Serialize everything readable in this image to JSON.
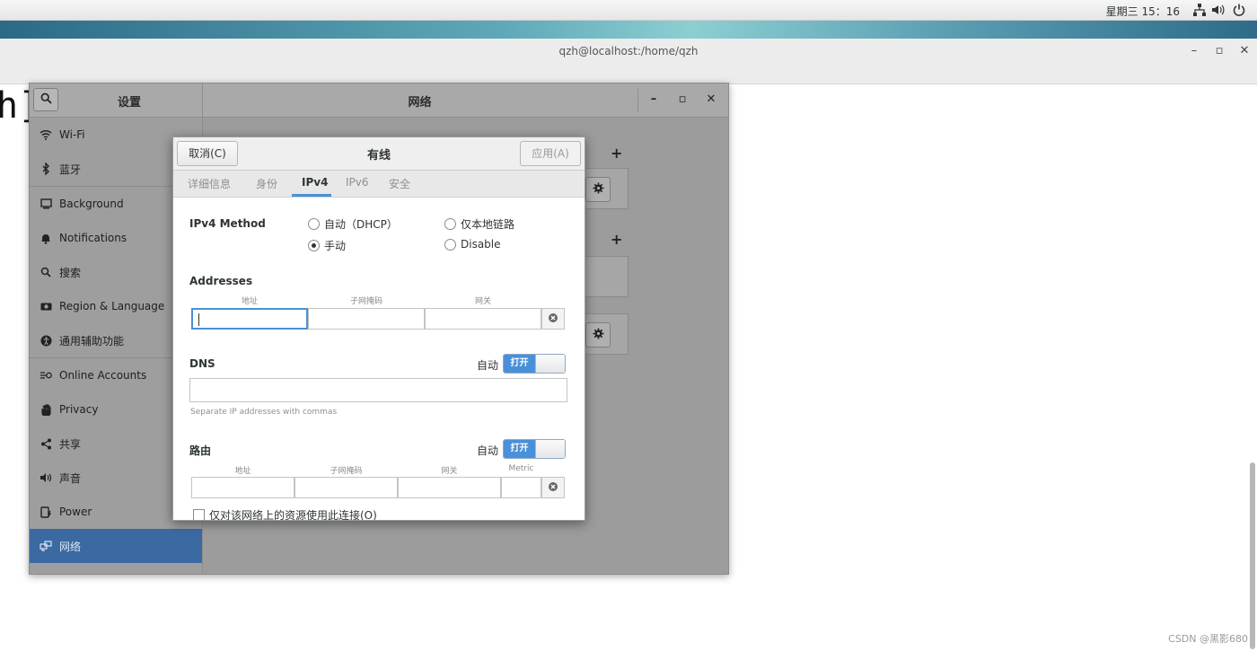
{
  "topbar": {
    "clock": "星期三 15：16",
    "icons": [
      "network-icon",
      "volume-icon",
      "power-icon"
    ]
  },
  "terminal": {
    "title": "qzh@localhost:/home/qzh",
    "prompt_fragment": "h]",
    "controls": {
      "minimize": "–",
      "maximize": "▫",
      "close": "✕"
    }
  },
  "settings": {
    "left_title": "设置",
    "main_title": "网络",
    "controls": {
      "minimize": "–",
      "maximize": "▫",
      "close": "✕"
    },
    "sidebar": {
      "items": [
        {
          "label": "Wi-Fi",
          "icon": "wifi-icon"
        },
        {
          "label": "蓝牙",
          "icon": "bluetooth-icon"
        },
        {
          "label": "Background",
          "icon": "background-icon"
        },
        {
          "label": "Notifications",
          "icon": "bell-icon"
        },
        {
          "label": "搜索",
          "icon": "search-icon"
        },
        {
          "label": "Region & Language",
          "icon": "region-icon"
        },
        {
          "label": "通用辅助功能",
          "icon": "accessibility-icon"
        },
        {
          "label": "Online Accounts",
          "icon": "online-accounts-icon"
        },
        {
          "label": "Privacy",
          "icon": "privacy-icon"
        },
        {
          "label": "共享",
          "icon": "share-icon"
        },
        {
          "label": "声音",
          "icon": "sound-icon"
        },
        {
          "label": "Power",
          "icon": "power-icon"
        },
        {
          "label": "网络",
          "icon": "network-icon"
        }
      ],
      "active_index": 12
    },
    "content": {
      "plus": "+"
    }
  },
  "dialog": {
    "cancel_label": "取消(C)",
    "title": "有线",
    "apply_label": "应用(A)",
    "tabs": [
      {
        "label": "详细信息"
      },
      {
        "label": "身份"
      },
      {
        "label": "IPv4"
      },
      {
        "label": "IPv6"
      },
      {
        "label": "安全"
      }
    ],
    "active_tab": "IPv4",
    "ipv4": {
      "method_label": "IPv4 Method",
      "methods": [
        {
          "label": "自动（DHCP）",
          "checked": false
        },
        {
          "label": "仅本地链路",
          "checked": false
        },
        {
          "label": "手动",
          "checked": true
        },
        {
          "label": "Disable",
          "checked": false
        }
      ],
      "addresses_label": "Addresses",
      "address_columns": [
        "地址",
        "子网掩码",
        "网关"
      ],
      "dns_label": "DNS",
      "dns_auto_label": "自动",
      "dns_switch_label": "打开",
      "dns_value": "",
      "dns_hint": "Separate IP addresses with commas",
      "routes_label": "路由",
      "routes_auto_label": "自动",
      "routes_switch_label": "打开",
      "route_columns": [
        "地址",
        "子网掩码",
        "网关",
        "Metric"
      ],
      "only_local_label": "仅对该网络上的资源使用此连接(O)"
    }
  },
  "watermark": "CSDN @黑影680",
  "colors": {
    "accent": "#4a90d9",
    "sidebar_active": "#3b6aa3"
  }
}
